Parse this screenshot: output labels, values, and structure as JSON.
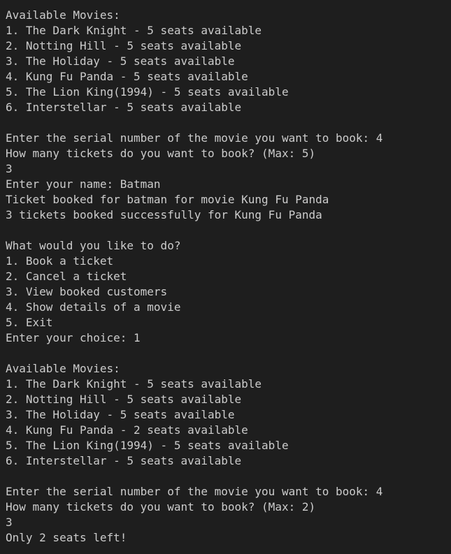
{
  "terminal": {
    "lines": [
      "Available Movies:",
      "1. The Dark Knight - 5 seats available",
      "2. Notting Hill - 5 seats available",
      "3. The Holiday - 5 seats available",
      "4. Kung Fu Panda - 5 seats available",
      "5. The Lion King(1994) - 5 seats available",
      "6. Interstellar - 5 seats available",
      "",
      "Enter the serial number of the movie you want to book: 4",
      "How many tickets do you want to book? (Max: 5)",
      "3",
      "Enter your name: Batman",
      "Ticket booked for batman for movie Kung Fu Panda",
      "3 tickets booked successfully for Kung Fu Panda",
      "",
      "What would you like to do?",
      "1. Book a ticket",
      "2. Cancel a ticket",
      "3. View booked customers",
      "4. Show details of a movie",
      "5. Exit",
      "Enter your choice: 1",
      "",
      "Available Movies:",
      "1. The Dark Knight - 5 seats available",
      "2. Notting Hill - 5 seats available",
      "3. The Holiday - 5 seats available",
      "4. Kung Fu Panda - 2 seats available",
      "5. The Lion King(1994) - 5 seats available",
      "6. Interstellar - 5 seats available",
      "",
      "Enter the serial number of the movie you want to book: 4",
      "How many tickets do you want to book? (Max: 2)",
      "3",
      "Only 2 seats left!"
    ]
  },
  "colors": {
    "background": "#1e1e1e",
    "text": "#cccccc"
  }
}
